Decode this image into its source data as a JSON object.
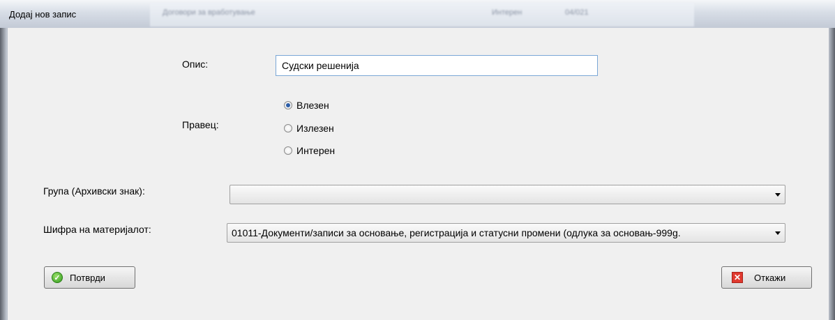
{
  "window": {
    "title": "Додај нов запис",
    "background_text": [
      "Договори за вработување",
      "Интерен",
      "04/021"
    ]
  },
  "form": {
    "opis_label": "Опис:",
    "opis_value": "Судски решенија",
    "pravec_label": "Правец:",
    "radios": [
      {
        "label": "Влезен",
        "selected": true
      },
      {
        "label": "Излезен",
        "selected": false
      },
      {
        "label": "Интерен",
        "selected": false
      }
    ],
    "grupa_label": "Група (Архивски знак):",
    "grupa_value": "",
    "shifra_label": "Шифра на материјалот:",
    "shifra_value": "01011-Документи/записи за основање, регистрација и статусни промени (одлука за основањ-999g."
  },
  "buttons": {
    "confirm": "Потврди",
    "cancel": "Откажи"
  },
  "colors": {
    "accent": "#2b5da8",
    "confirm_icon": "#2f9a1c",
    "cancel_icon": "#e0392f"
  },
  "icons": {
    "confirm": "check-circle-icon",
    "cancel": "close-box-icon"
  }
}
